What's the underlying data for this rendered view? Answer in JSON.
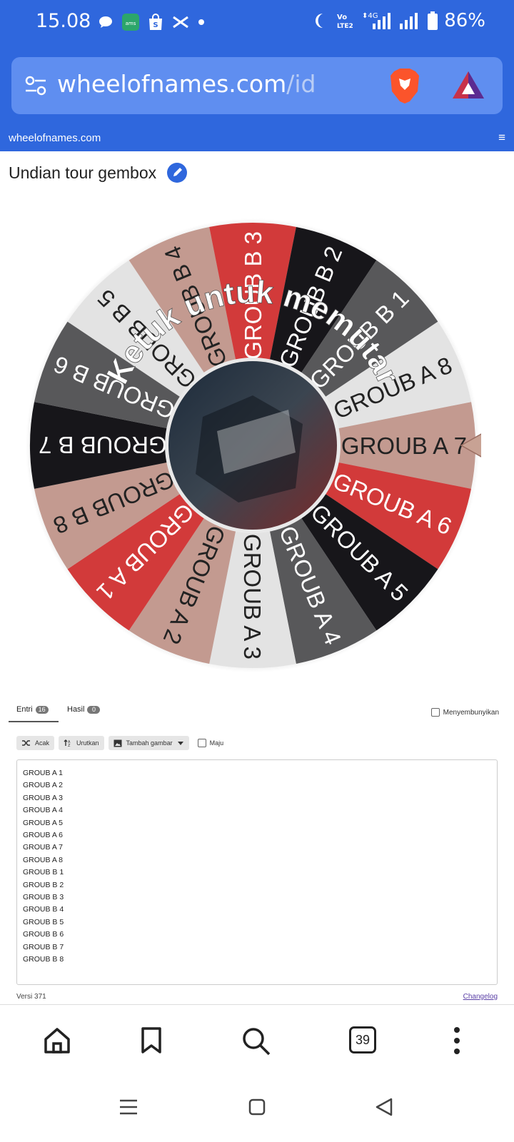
{
  "status_bar": {
    "time": "15.08",
    "battery": "86%",
    "network": "4G"
  },
  "browser": {
    "url_domain": "wheelofnames.com",
    "url_path": "/id",
    "tab_count": "39"
  },
  "site": {
    "title": "wheelofnames.com",
    "menu_icon": "hamburger-icon"
  },
  "page": {
    "title": "Undian tour gembox"
  },
  "wheel": {
    "spin_text": "Ketuk untuk memutar",
    "segments": [
      {
        "label": "GROUB A 7",
        "color": "#c39a90",
        "text_color": "#222222"
      },
      {
        "label": "GROUB A 6",
        "color": "#d23a3a",
        "text_color": "#ffffff"
      },
      {
        "label": "GROUB A 5",
        "color": "#17161a",
        "text_color": "#ffffff"
      },
      {
        "label": "GROUB A 4",
        "color": "#58585a",
        "text_color": "#ffffff"
      },
      {
        "label": "GROUB A 3",
        "color": "#e3e3e3",
        "text_color": "#222222"
      },
      {
        "label": "GROUB A 2",
        "color": "#c39a90",
        "text_color": "#222222"
      },
      {
        "label": "GROUB A 1",
        "color": "#d23a3a",
        "text_color": "#ffffff"
      },
      {
        "label": "GROUB B 8",
        "color": "#c39a90",
        "text_color": "#222222"
      },
      {
        "label": "GROUB B 7",
        "color": "#17161a",
        "text_color": "#ffffff"
      },
      {
        "label": "GROUB B 6",
        "color": "#58585a",
        "text_color": "#ffffff"
      },
      {
        "label": "GROUB B 5",
        "color": "#e3e3e3",
        "text_color": "#222222"
      },
      {
        "label": "GROUB B 4",
        "color": "#c39a90",
        "text_color": "#222222"
      },
      {
        "label": "GROUB B 3",
        "color": "#d23a3a",
        "text_color": "#ffffff"
      },
      {
        "label": "GROUB B 2",
        "color": "#17161a",
        "text_color": "#ffffff"
      },
      {
        "label": "GROUB B 1",
        "color": "#58585a",
        "text_color": "#ffffff"
      },
      {
        "label": "GROUB A 8",
        "color": "#e3e3e3",
        "text_color": "#222222"
      }
    ]
  },
  "tabs": {
    "entri_label": "Entri",
    "entri_count": "16",
    "hasil_label": "Hasil",
    "hasil_count": "0",
    "hide_label": "Menyembunyikan"
  },
  "toolbar": {
    "shuffle_label": "Acak",
    "sort_label": "Urutkan",
    "add_image_label": "Tambah gambar",
    "advanced_label": "Maju"
  },
  "entries": [
    "GROUB A 1",
    "GROUB A 2",
    "GROUB A 3",
    "GROUB A 4",
    "GROUB A 5",
    "GROUB A 6",
    "GROUB A 7",
    "GROUB A 8",
    "GROUB B 1",
    "GROUB B 2",
    "GROUB B 3",
    "GROUB B 4",
    "GROUB B 5",
    "GROUB B 6",
    "GROUB B 7",
    "GROUB B 8"
  ],
  "footer": {
    "version": "Versi 371",
    "changelog": "Changelog"
  }
}
